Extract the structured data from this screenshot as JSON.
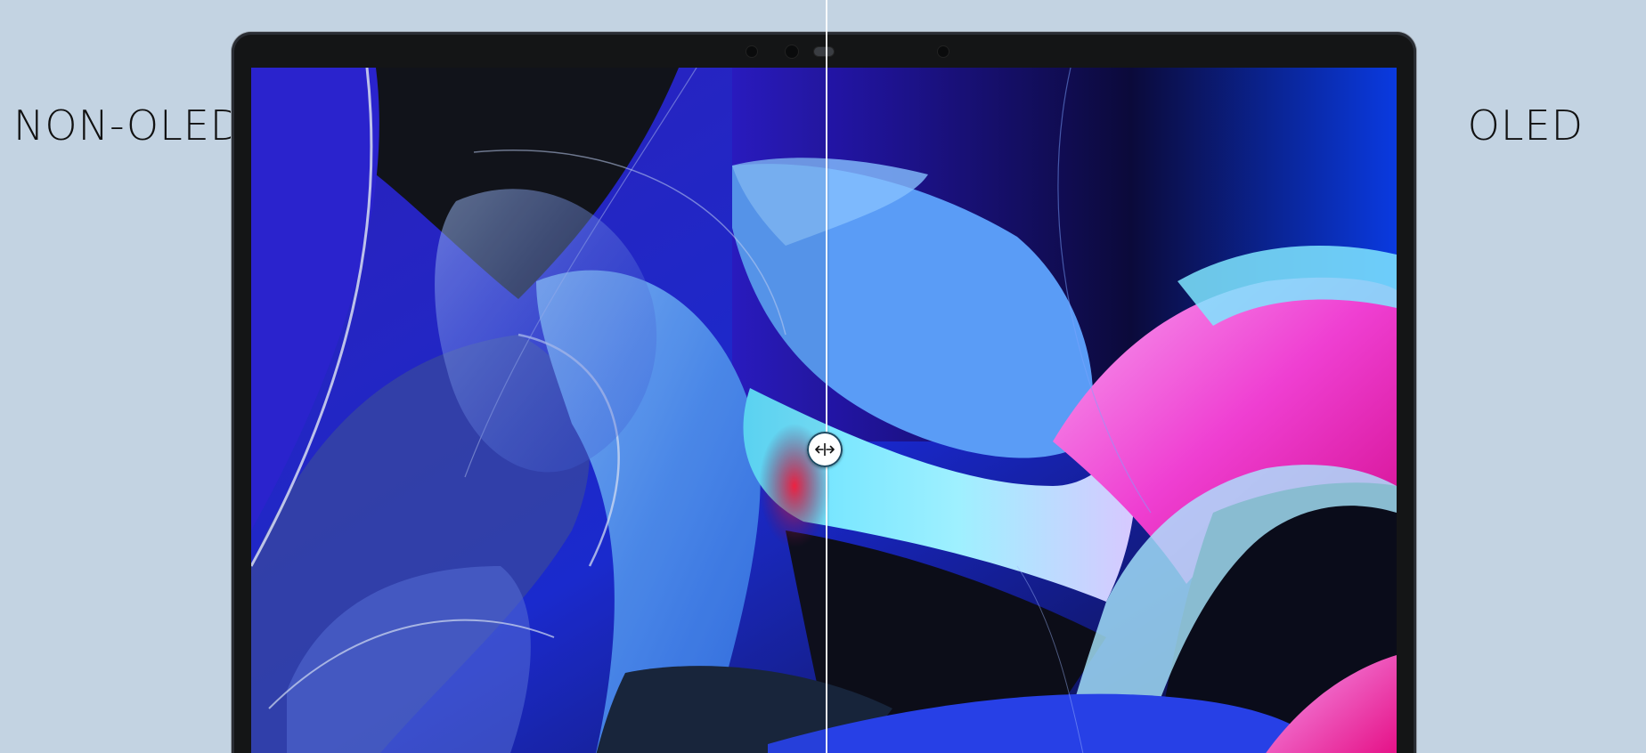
{
  "comparison": {
    "left_label": "NON-OLED",
    "right_label": "OLED",
    "slider_position_percent": 50.2
  },
  "icons": {
    "handle": "arrows-left-right-icon"
  },
  "colors": {
    "background": "#c3d3e2",
    "bezel": "#141516",
    "handle_ring": "#1c4a63"
  }
}
